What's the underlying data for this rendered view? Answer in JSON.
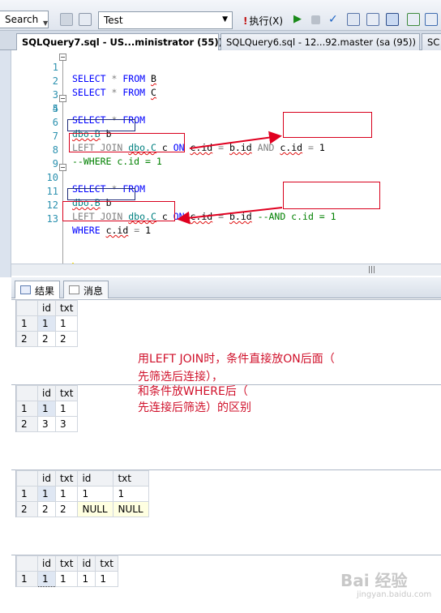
{
  "toolbar": {
    "search_label": "Search",
    "database": "Test",
    "execute_label": "执行(X)"
  },
  "tabs": [
    {
      "label": "SQLQuery7.sql - US...ministrator (55))*",
      "active": true
    },
    {
      "label": "SQLQuery6.sql - 12...92.master (sa (95))",
      "active": false
    },
    {
      "label": "SC",
      "active": false
    }
  ],
  "editor": {
    "lines": [
      {
        "num": "1",
        "text": "SELECT * FROM B"
      },
      {
        "num": "2",
        "text": "SELECT * FROM C"
      },
      {
        "num": "3",
        "text": ""
      },
      {
        "num": "4",
        "text": ""
      },
      {
        "num": "5",
        "text": "SELECT * FROM"
      },
      {
        "num": "6",
        "text": "dbo.B b"
      },
      {
        "num": "7",
        "text": "LEFT JOIN dbo.C c ON c.id = b.id AND c.id = 1"
      },
      {
        "num": "8",
        "text": "--WHERE c.id = 1"
      },
      {
        "num": "9",
        "text": ""
      },
      {
        "num": "10",
        "text": "SELECT * FROM"
      },
      {
        "num": "11",
        "text": "dbo.B b"
      },
      {
        "num": "12",
        "text": "LEFT JOIN dbo.C c ON c.id = b.id --AND c.id = 1"
      },
      {
        "num": "13",
        "text": "WHERE c.id = 1"
      }
    ]
  },
  "result_tabs": {
    "results": "结果",
    "messages": "消息"
  },
  "grids": [
    {
      "headers": [
        "id",
        "txt"
      ],
      "rows": [
        [
          "1",
          "1",
          "1"
        ],
        [
          "2",
          "2",
          "2"
        ]
      ]
    },
    {
      "headers": [
        "id",
        "txt"
      ],
      "rows": [
        [
          "1",
          "1",
          "1"
        ],
        [
          "2",
          "3",
          "3"
        ]
      ]
    },
    {
      "headers": [
        "id",
        "txt",
        "id",
        "txt"
      ],
      "rows": [
        [
          "1",
          "1",
          "1",
          "1",
          "1"
        ],
        [
          "2",
          "2",
          "2",
          "NULL",
          "NULL"
        ]
      ]
    },
    {
      "headers": [
        "id",
        "txt",
        "id",
        "txt"
      ],
      "rows": [
        [
          "1",
          "1",
          "1",
          "1",
          "1"
        ]
      ]
    }
  ],
  "annotation": {
    "line1": "用LEFT JOIN时，条件直接放ON后面（",
    "line2": "先筛选后连接），",
    "line3": "和条件放WHERE后（",
    "line4": "先连接后筛选）的区别"
  },
  "watermark": {
    "text": "Bai 经验",
    "sub": "jingyan.baidu.com"
  },
  "colors": {
    "keyword": "#0000ff",
    "comment": "#008000",
    "object": "#008080",
    "annotation": "#d0112b",
    "null_cell": "#ffffe1"
  }
}
